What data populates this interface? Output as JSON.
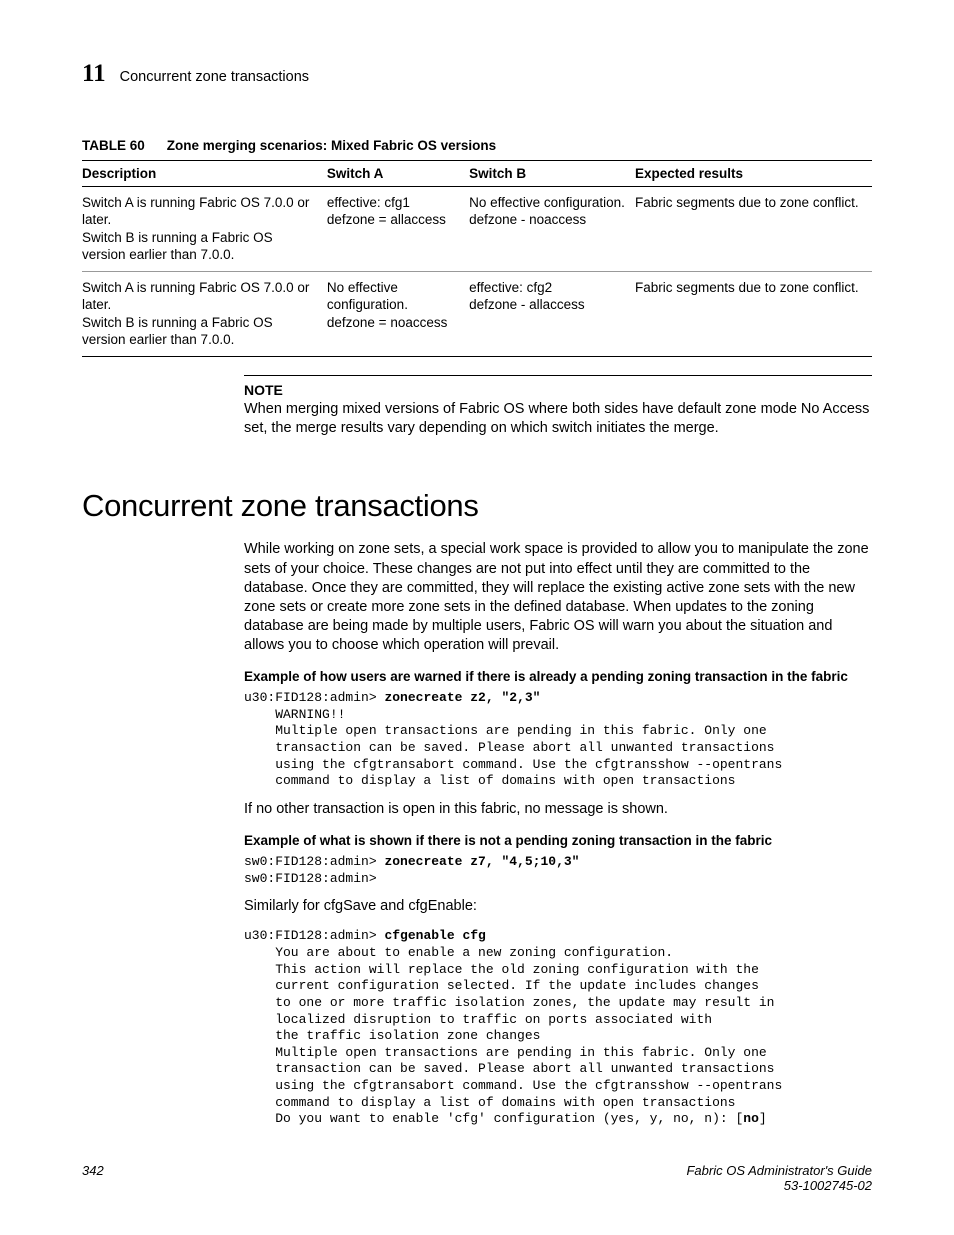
{
  "header": {
    "chapter_number": "11",
    "chapter_title": "Concurrent zone transactions"
  },
  "table": {
    "label": "TABLE 60",
    "caption": "Zone merging scenarios: Mixed Fabric OS versions",
    "headers": {
      "desc": "Description",
      "a": "Switch A",
      "b": "Switch B",
      "exp": "Expected results"
    },
    "rows": [
      {
        "desc": "Switch A is running Fabric OS 7.0.0 or later.\nSwitch B is running a Fabric OS version earlier than 7.0.0.",
        "a": "effective: cfg1\ndefzone = allaccess",
        "b": "No effective configuration.\ndefzone - noaccess",
        "exp": "Fabric segments due to zone conflict."
      },
      {
        "desc": "Switch A is running Fabric OS 7.0.0 or later.\nSwitch B is running a Fabric OS version earlier than 7.0.0.",
        "a": "No effective configuration.\ndefzone = noaccess",
        "b": "effective: cfg2\ndefzone - allaccess",
        "exp": "Fabric segments due to zone conflict."
      }
    ]
  },
  "note": {
    "label": "NOTE",
    "text": "When merging mixed versions of Fabric OS where both sides have default zone mode No Access set, the merge results vary depending on which switch initiates the merge."
  },
  "section_heading": "Concurrent zone transactions",
  "intro_para": "While working on zone sets, a special work space is provided to allow you to manipulate the zone sets of your choice. These changes are not put into effect until they are committed to the database. Once they are committed, they will replace the existing active zone sets with the new zone sets or create more zone sets in the defined database. When updates to the zoning database are being made by multiple users, Fabric OS will warn you about the situation and allows you to choose which operation will prevail.",
  "example1": {
    "heading": "Example of how users are warned if there is already a pending zoning transaction in the fabric",
    "prompt": "u30:FID128:admin> ",
    "cmd": "zonecreate z2, \"2,3\"",
    "body": "    WARNING!!\n    Multiple open transactions are pending in this fabric. Only one\n    transaction can be saved. Please abort all unwanted transactions\n    using the cfgtransabort command. Use the cfgtransshow --opentrans\n    command to display a list of domains with open transactions"
  },
  "mid_para": "If no other transaction is open in this fabric, no message is shown.",
  "example2": {
    "heading": "Example of what is shown if there is not a pending zoning transaction in the fabric",
    "line1_prompt": "sw0:FID128:admin> ",
    "line1_cmd": "zonecreate z7, \"4,5;10,3\"",
    "line2": "sw0:FID128:admin>"
  },
  "similarly": "Similarly for cfgSave and cfgEnable:",
  "example3": {
    "prompt": "u30:FID128:admin> ",
    "cmd": "cfgenable cfg",
    "body": "    You are about to enable a new zoning configuration.\n    This action will replace the old zoning configuration with the\n    current configuration selected. If the update includes changes\n    to one or more traffic isolation zones, the update may result in\n    localized disruption to traffic on ports associated with\n    the traffic isolation zone changes\n    Multiple open transactions are pending in this fabric. Only one\n    transaction can be saved. Please abort all unwanted transactions\n    using the cfgtransabort command. Use the cfgtransshow --opentrans\n    command to display a list of domains with open transactions\n    Do you want to enable 'cfg' configuration (yes, y, no, n): [",
    "body_bold": "no",
    "body_after": "]"
  },
  "footer": {
    "page": "342",
    "title": "Fabric OS Administrator's Guide",
    "docnum": "53-1002745-02"
  }
}
